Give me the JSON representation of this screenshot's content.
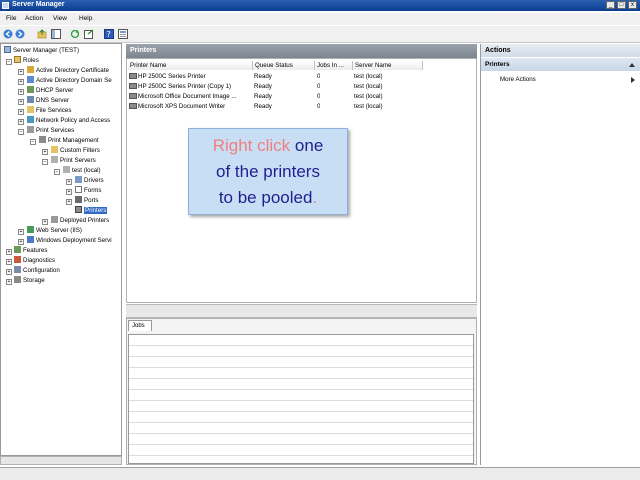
{
  "window": {
    "title": "Server Manager",
    "controls": [
      "_",
      "□",
      "x"
    ]
  },
  "menu": [
    "File",
    "Action",
    "View",
    "Help"
  ],
  "toolbar": {
    "icons": [
      "back-icon",
      "forward-icon",
      "up-icon",
      "show-hide-tree-icon",
      "refresh-icon",
      "export-icon",
      "help-icon",
      "properties-icon"
    ]
  },
  "tree": {
    "root": "Server Manager (TEST)",
    "roles": "Roles",
    "ad_cert": "Active Directory Certificate",
    "ad_domain": "Active Directory Domain Se",
    "dhcp": "DHCP Server",
    "dns": "DNS Server",
    "file": "File Services",
    "npas": "Network Policy and Access",
    "print_services": "Print Services",
    "print_mgmt": "Print Management",
    "custom_filters": "Custom Filters",
    "print_servers": "Print Servers",
    "test_local": "test (local)",
    "drivers": "Drivers",
    "forms": "Forms",
    "ports": "Ports",
    "printers": "Printers",
    "deployed": "Deployed Printers",
    "web_server": "Web Server (IIS)",
    "wds": "Windows Deployment Servi",
    "features": "Features",
    "diagnostics": "Diagnostics",
    "configuration": "Configuration",
    "storage": "Storage"
  },
  "center": {
    "title": "Printers",
    "columns": [
      "Printer Name",
      "Queue Status",
      "Jobs In ...",
      "Server Name"
    ],
    "rows": [
      {
        "name": "HP 2500C Series Printer",
        "status": "Ready",
        "jobs": "0",
        "server": "test (local)"
      },
      {
        "name": "HP 2500C Series Printer (Copy 1)",
        "status": "Ready",
        "jobs": "0",
        "server": "test (local)"
      },
      {
        "name": "Microsoft Office Document Image ...",
        "status": "Ready",
        "jobs": "0",
        "server": "test (local)"
      },
      {
        "name": "Microsoft XPS Document Writer",
        "status": "Ready",
        "jobs": "0",
        "server": "test (local)"
      }
    ],
    "jobs_tab": "Jobs"
  },
  "actions": {
    "title": "Actions",
    "section": "Printers",
    "more": "More Actions"
  },
  "callout": {
    "part1_highlight": "Right click",
    "part1_rest": " one",
    "line2": "of the printers",
    "line3": "to be pooled",
    "end": "."
  },
  "colors": {
    "titlebar": "#0a3d8f",
    "selection": "#3169c6",
    "callout_bg": "#c8def4",
    "callout_text": "#1f1f8f",
    "callout_highlight": "#f08080"
  }
}
